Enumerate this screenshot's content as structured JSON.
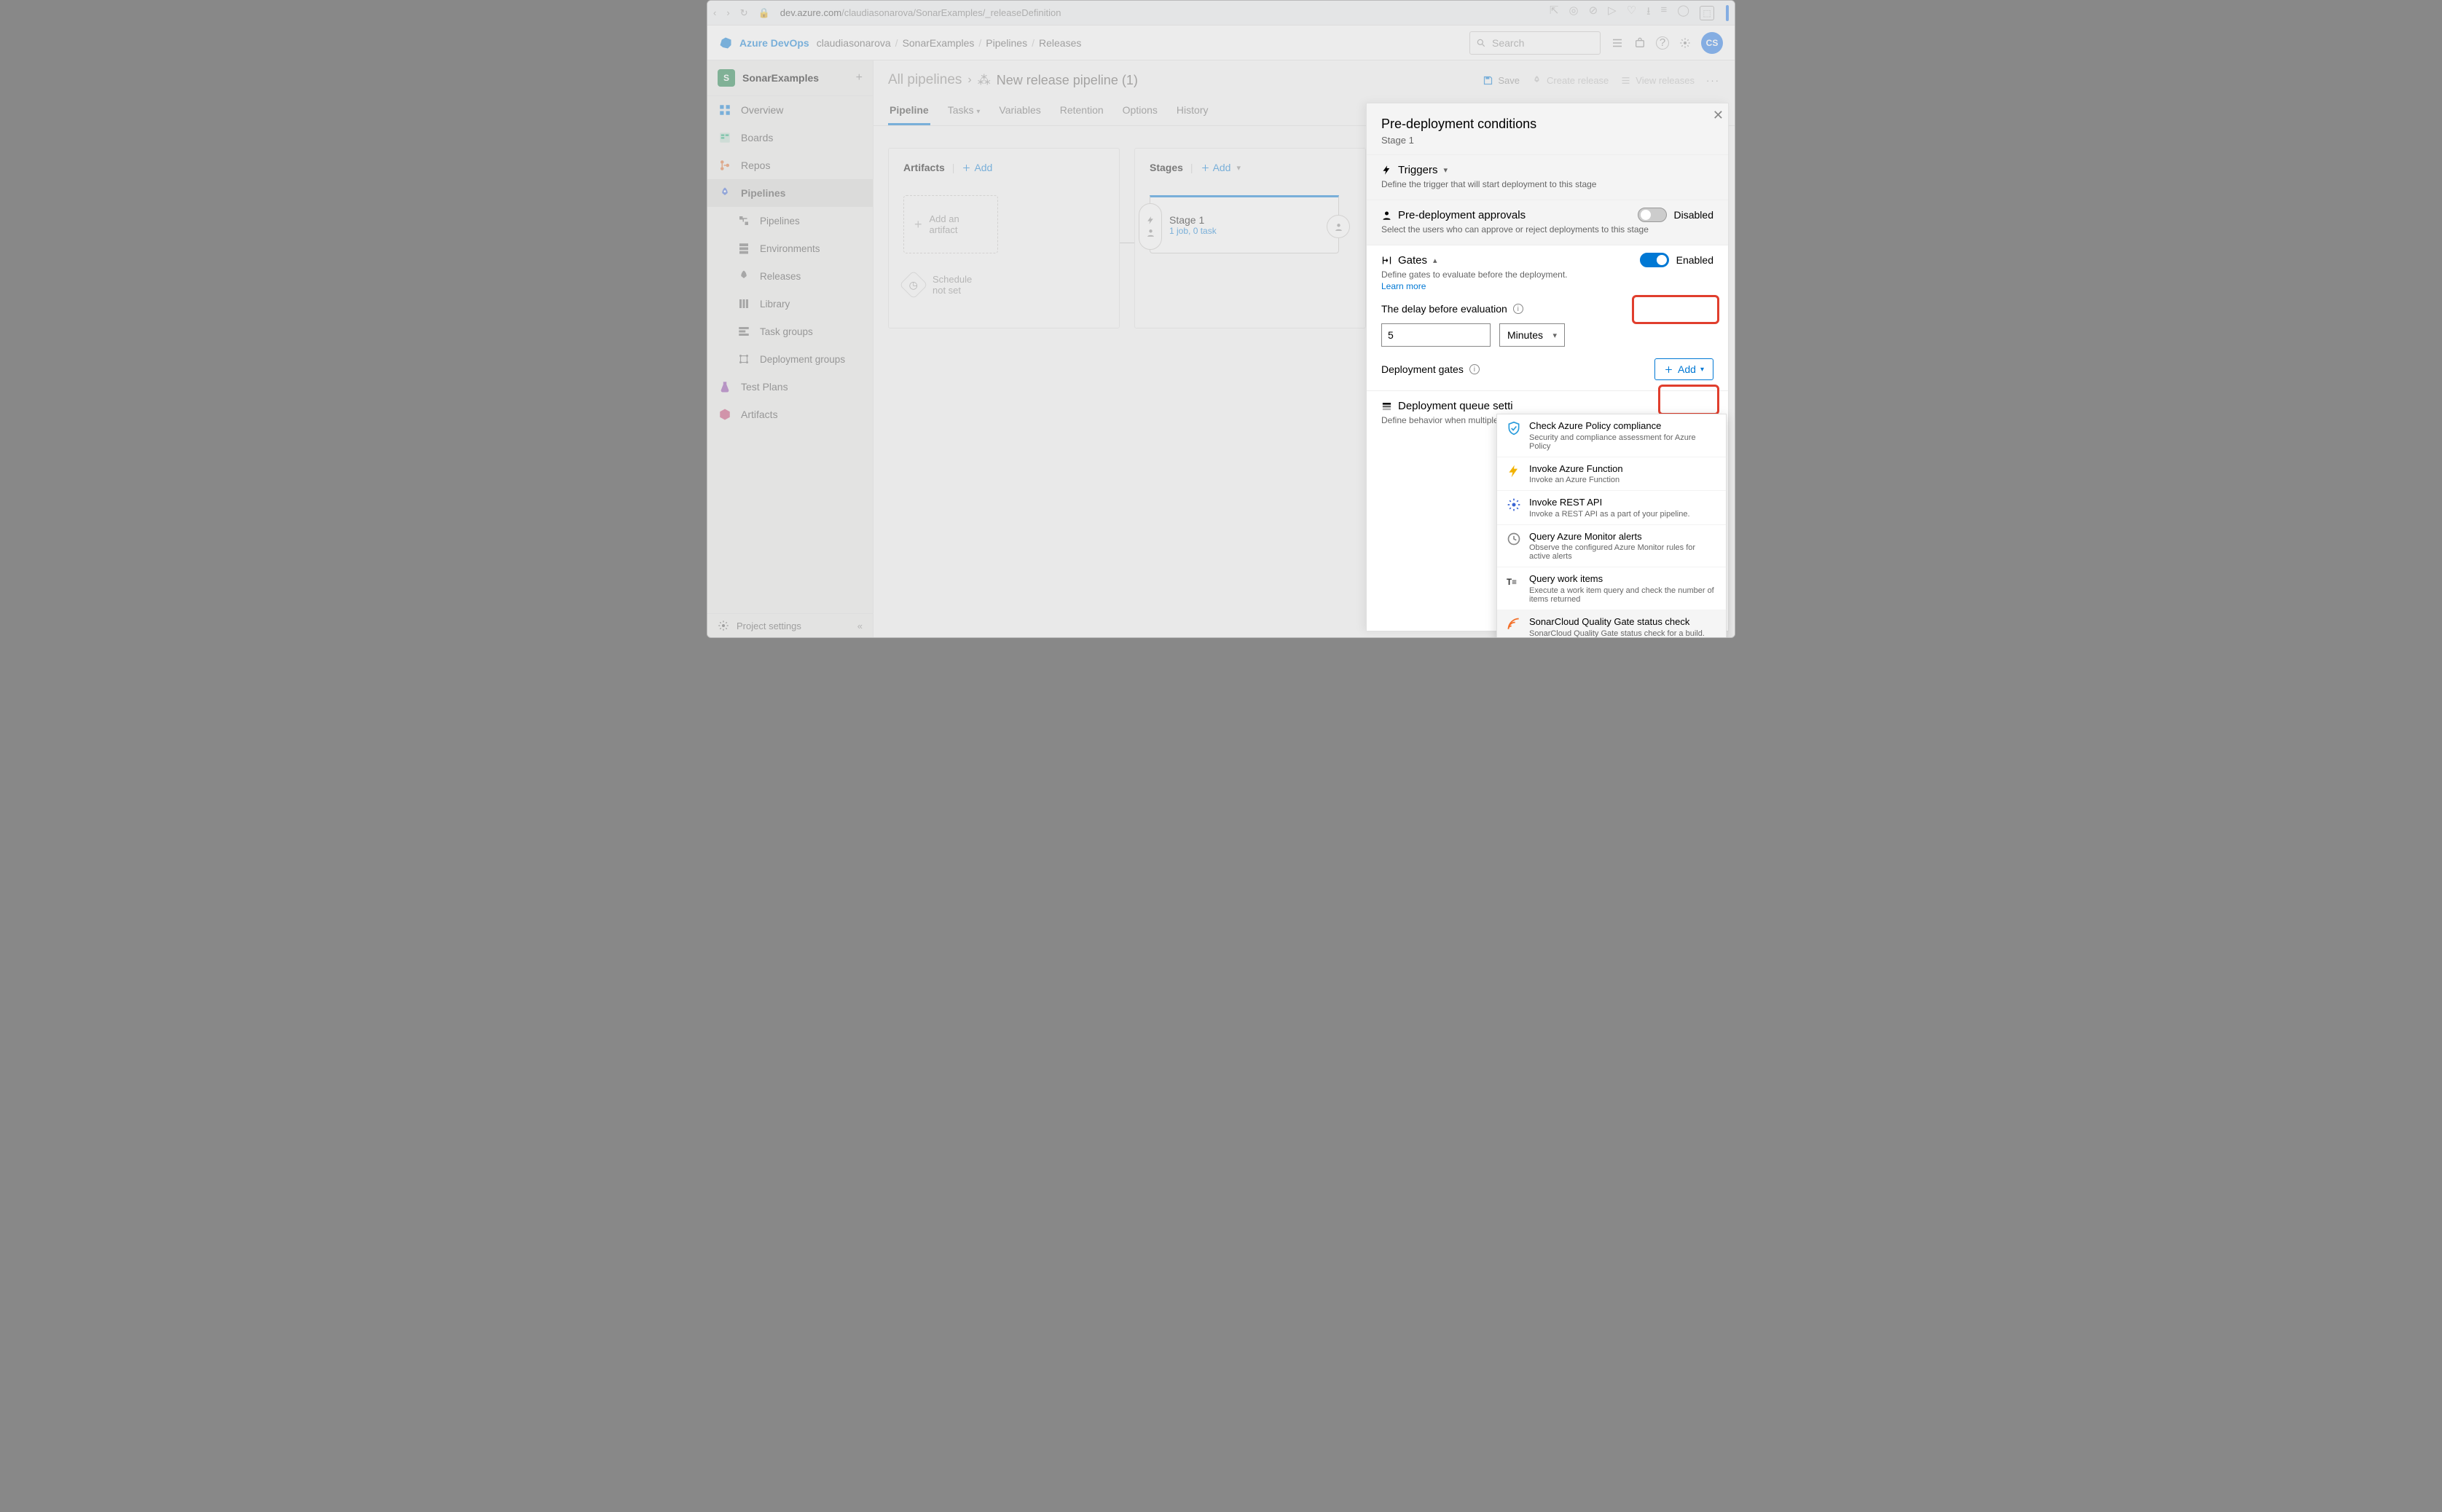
{
  "browser": {
    "url_host": "dev.azure.com",
    "url_path": "/claudiasonarova/SonarExamples/_releaseDefinition"
  },
  "header": {
    "brand": "Azure DevOps",
    "crumbs": [
      "claudiasonarova",
      "SonarExamples",
      "Pipelines",
      "Releases"
    ],
    "search_placeholder": "Search",
    "avatar": "CS"
  },
  "sidebar": {
    "project": "SonarExamples",
    "project_initial": "S",
    "items": [
      {
        "label": "Overview",
        "icon": "#ic-grid",
        "color": "#0078d4"
      },
      {
        "label": "Boards",
        "icon": "#ic-board",
        "color": "#0aa66e"
      },
      {
        "label": "Repos",
        "icon": "#ic-repo",
        "color": "#e06c2a"
      },
      {
        "label": "Pipelines",
        "icon": "#ic-rocket",
        "color": "#3a65d4",
        "selected": true,
        "bold": true
      },
      {
        "label": "Pipelines",
        "icon": "#ic-pipe",
        "sub": true
      },
      {
        "label": "Environments",
        "icon": "#ic-env",
        "sub": true
      },
      {
        "label": "Releases",
        "icon": "#ic-release",
        "sub": true
      },
      {
        "label": "Library",
        "icon": "#ic-lib",
        "sub": true
      },
      {
        "label": "Task groups",
        "icon": "#ic-task",
        "sub": true
      },
      {
        "label": "Deployment groups",
        "icon": "#ic-deploy",
        "sub": true
      },
      {
        "label": "Test Plans",
        "icon": "#ic-flask",
        "color": "#8a3fa6"
      },
      {
        "label": "Artifacts",
        "icon": "#ic-pkg",
        "color": "#c33d6e"
      }
    ],
    "settings": "Project settings"
  },
  "content": {
    "all_pipelines": "All pipelines",
    "pipeline_title": "New release pipeline (1)",
    "actions": {
      "save": "Save",
      "create_release": "Create release",
      "view_releases": "View releases"
    },
    "tabs": [
      "Pipeline",
      "Tasks",
      "Variables",
      "Retention",
      "Options",
      "History"
    ],
    "artifacts_label": "Artifacts",
    "add": "Add",
    "stages_label": "Stages",
    "add_artifact": "Add an artifact",
    "schedule": [
      "Schedule",
      "not set"
    ],
    "stage": {
      "name": "Stage 1",
      "sub": "1 job, 0 task"
    }
  },
  "panel": {
    "title": "Pre-deployment conditions",
    "stage": "Stage 1",
    "triggers": {
      "label": "Triggers",
      "desc": "Define the trigger that will start deployment to this stage"
    },
    "approvals": {
      "label": "Pre-deployment approvals",
      "desc": "Select the users who can approve or reject deployments to this stage",
      "state": "Disabled"
    },
    "gates": {
      "label": "Gates",
      "desc": "Define gates to evaluate before the deployment.",
      "learn": "Learn more",
      "state": "Enabled",
      "delay_label": "The delay before evaluation",
      "delay_value": "5",
      "delay_unit": "Minutes"
    },
    "deployment_gates": {
      "label": "Deployment gates",
      "add": "Add"
    },
    "queue": {
      "label": "Deployment queue setti",
      "desc": "Define behavior when multiple rele"
    },
    "menu": [
      {
        "t": "Check Azure Policy compliance",
        "d": "Security and compliance assessment for Azure Policy",
        "icon": "#ic-policy",
        "color": "#2a9cdc"
      },
      {
        "t": "Invoke Azure Function",
        "d": "Invoke an Azure Function",
        "icon": "#ic-func",
        "color": "#f2b200"
      },
      {
        "t": "Invoke REST API",
        "d": "Invoke a REST API as a part of your pipeline.",
        "icon": "#ic-gear",
        "color": "#3a65d4"
      },
      {
        "t": "Query Azure Monitor alerts",
        "d": "Observe the configured Azure Monitor rules for active alerts",
        "icon": "#ic-monitor",
        "color": "#888"
      },
      {
        "t": "Query work items",
        "d": "Execute a work item query and check the number of items returned",
        "icon": "#ic-work",
        "color": "#333"
      },
      {
        "t": "SonarCloud Quality Gate status check",
        "d": "SonarCloud Quality Gate status check for a build.",
        "icon": "#ic-sonar",
        "color": "#f3702a",
        "hilite": true
      }
    ]
  }
}
